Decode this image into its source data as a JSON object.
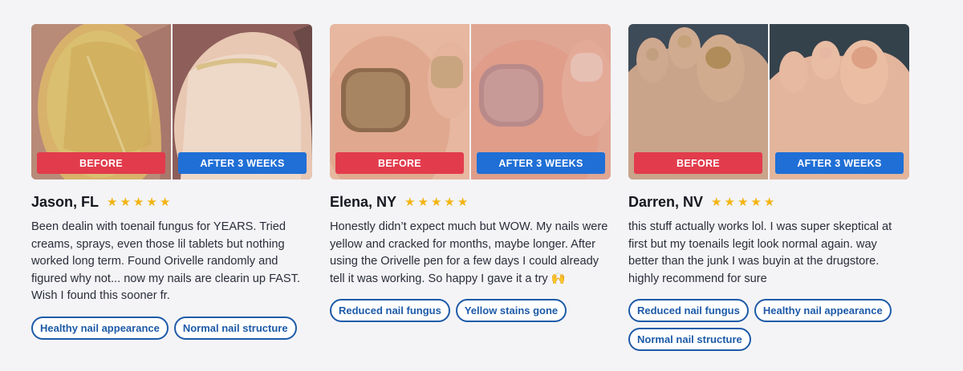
{
  "reviews": [
    {
      "name": "Jason, FL",
      "rating": 5,
      "before_label": "BEFORE",
      "after_label": "AFTER 3 WEEKS",
      "text": "Been dealin with toenail fungus for YEARS. Tried creams, sprays, even those lil tablets but nothing worked long term. Found Orivelle randomly and figured why not... now my nails are clearin up FAST. Wish I found this sooner fr.",
      "tags": [
        "Healthy nail appearance",
        "Normal nail structure"
      ]
    },
    {
      "name": "Elena, NY",
      "rating": 5,
      "before_label": "BEFORE",
      "after_label": "AFTER 3 WEEKS",
      "text": "Honestly didn’t expect much but WOW. My nails were yellow and cracked for months, maybe longer. After using the Orivelle pen for a few days I could already tell it was working. So happy I gave it a try 🙌",
      "tags": [
        "Reduced nail fungus",
        "Yellow stains gone"
      ]
    },
    {
      "name": "Darren, NV",
      "rating": 5,
      "before_label": "BEFORE",
      "after_label": "AFTER 3 WEEKS",
      "text": "this stuff actually works lol. I was super skeptical at first but my toenails legit look normal again. way better than the junk I was buyin at the drugstore. highly recommend for sure",
      "tags": [
        "Reduced nail fungus",
        "Healthy nail appearance",
        "Normal nail structure"
      ]
    }
  ],
  "colors": {
    "star": "#f3b414",
    "before_tag": "#e23b4c",
    "after_tag": "#1f6fd6",
    "chip_border": "#1d5aa8"
  }
}
